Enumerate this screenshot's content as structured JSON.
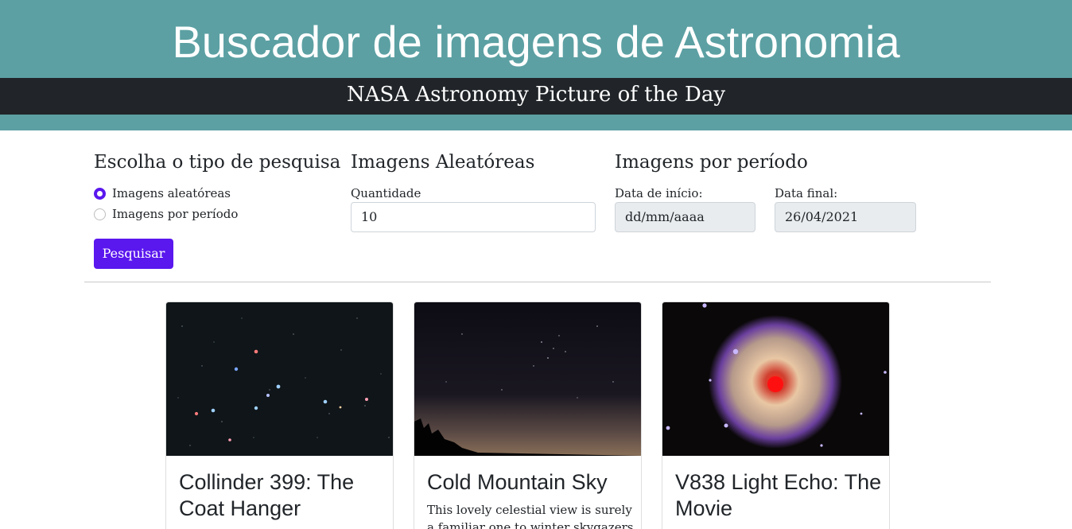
{
  "header": {
    "title": "Buscador de imagens de Astronomia",
    "subtitle": "NASA Astronomy Picture of the Day"
  },
  "search": {
    "type_heading": "Escolha o tipo de pesquisa",
    "options": [
      {
        "label": "Imagens aleatóreas",
        "checked": true
      },
      {
        "label": "Imagens por período",
        "checked": false
      }
    ],
    "submit_label": "Pesquisar",
    "random": {
      "heading": "Imagens Aleatóreas",
      "quantity_label": "Quantidade",
      "quantity_value": "10"
    },
    "period": {
      "heading": "Imagens por período",
      "start_label": "Data de início:",
      "start_placeholder": "dd/mm/aaaa",
      "end_label": "Data final:",
      "end_value": "26/04/2021"
    }
  },
  "colors": {
    "header_bg": "#5ca0a3",
    "subbar_bg": "#212529",
    "accent": "#5a17ee"
  },
  "cards": [
    {
      "title": "Collinder 399: The Coat Hanger",
      "text": ""
    },
    {
      "title": "Cold Mountain Sky",
      "text": "This lovely celestial view is surely a familiar one to winter skygazers in"
    },
    {
      "title": "V838 Light Echo: The Movie",
      "text": ""
    }
  ]
}
